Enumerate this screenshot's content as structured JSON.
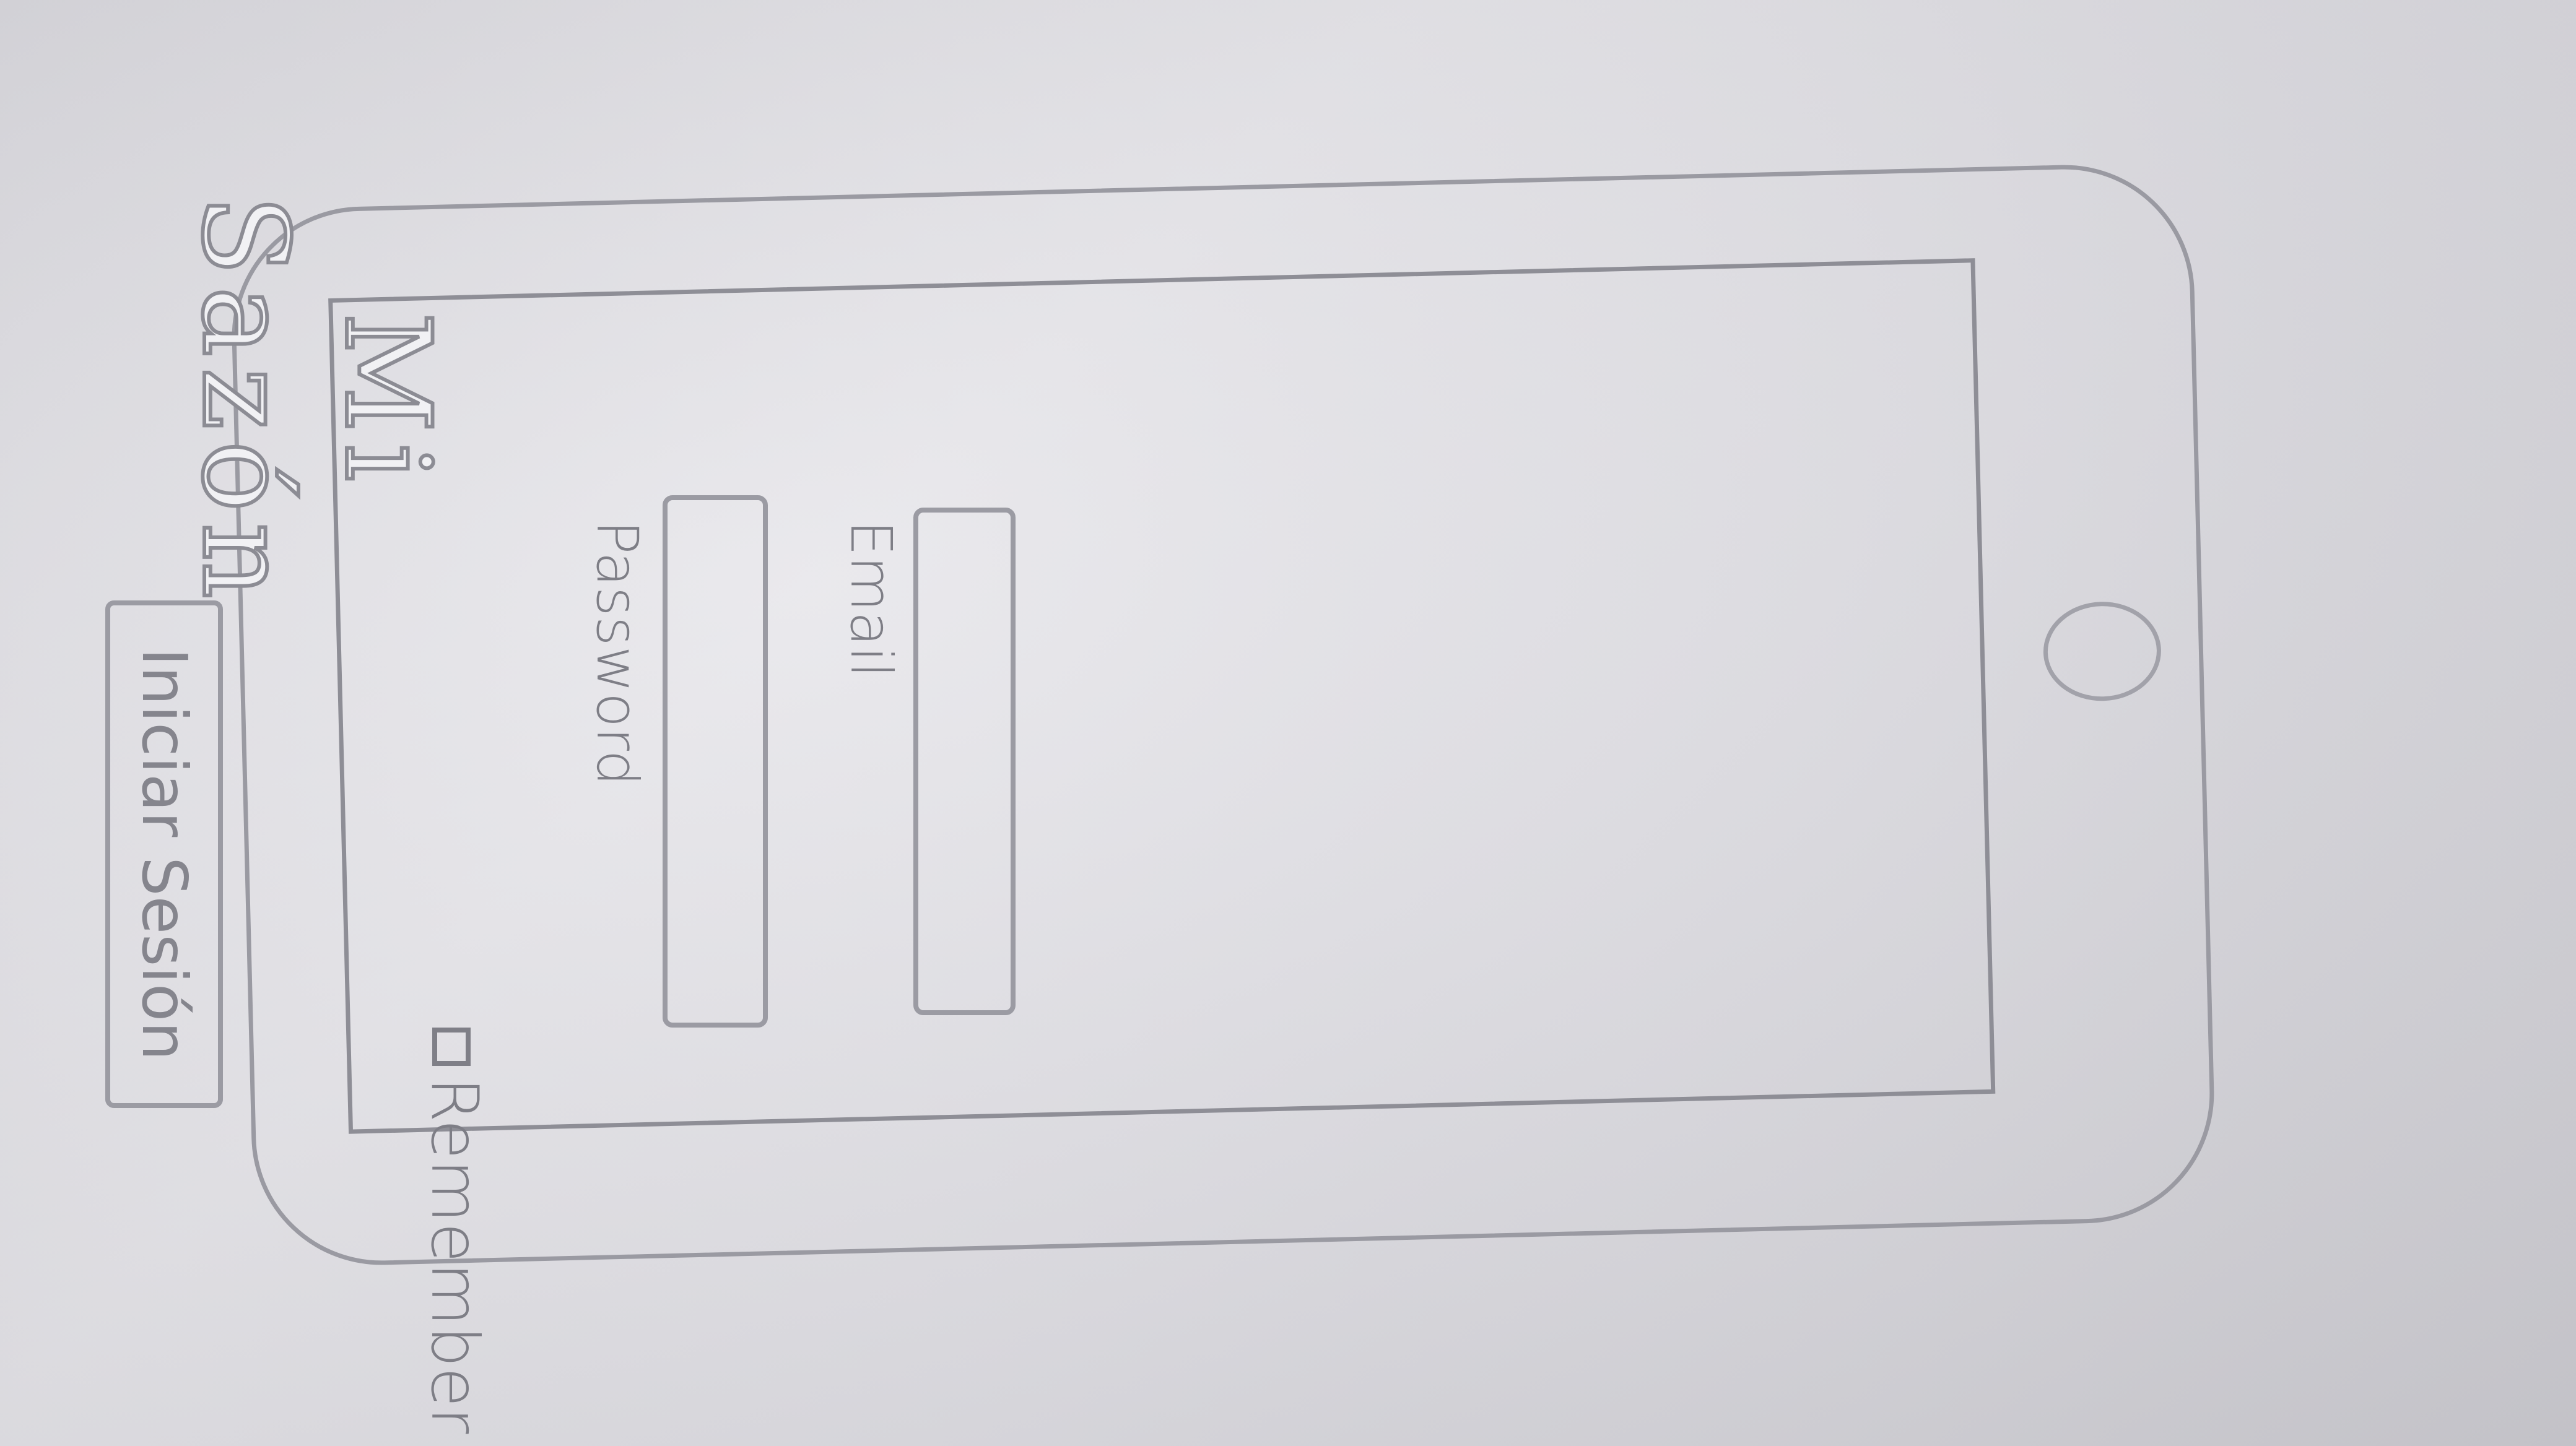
{
  "app": {
    "title": "Mi\nSazón"
  },
  "form": {
    "email_label": "Email",
    "email_value": "",
    "password_label": "Password",
    "password_value": "",
    "remember_label": "Remember",
    "submit_label": "Iniciar Sesión"
  },
  "colors": {
    "pencil": "#8e8e96",
    "paper": "#dcdbe1"
  }
}
